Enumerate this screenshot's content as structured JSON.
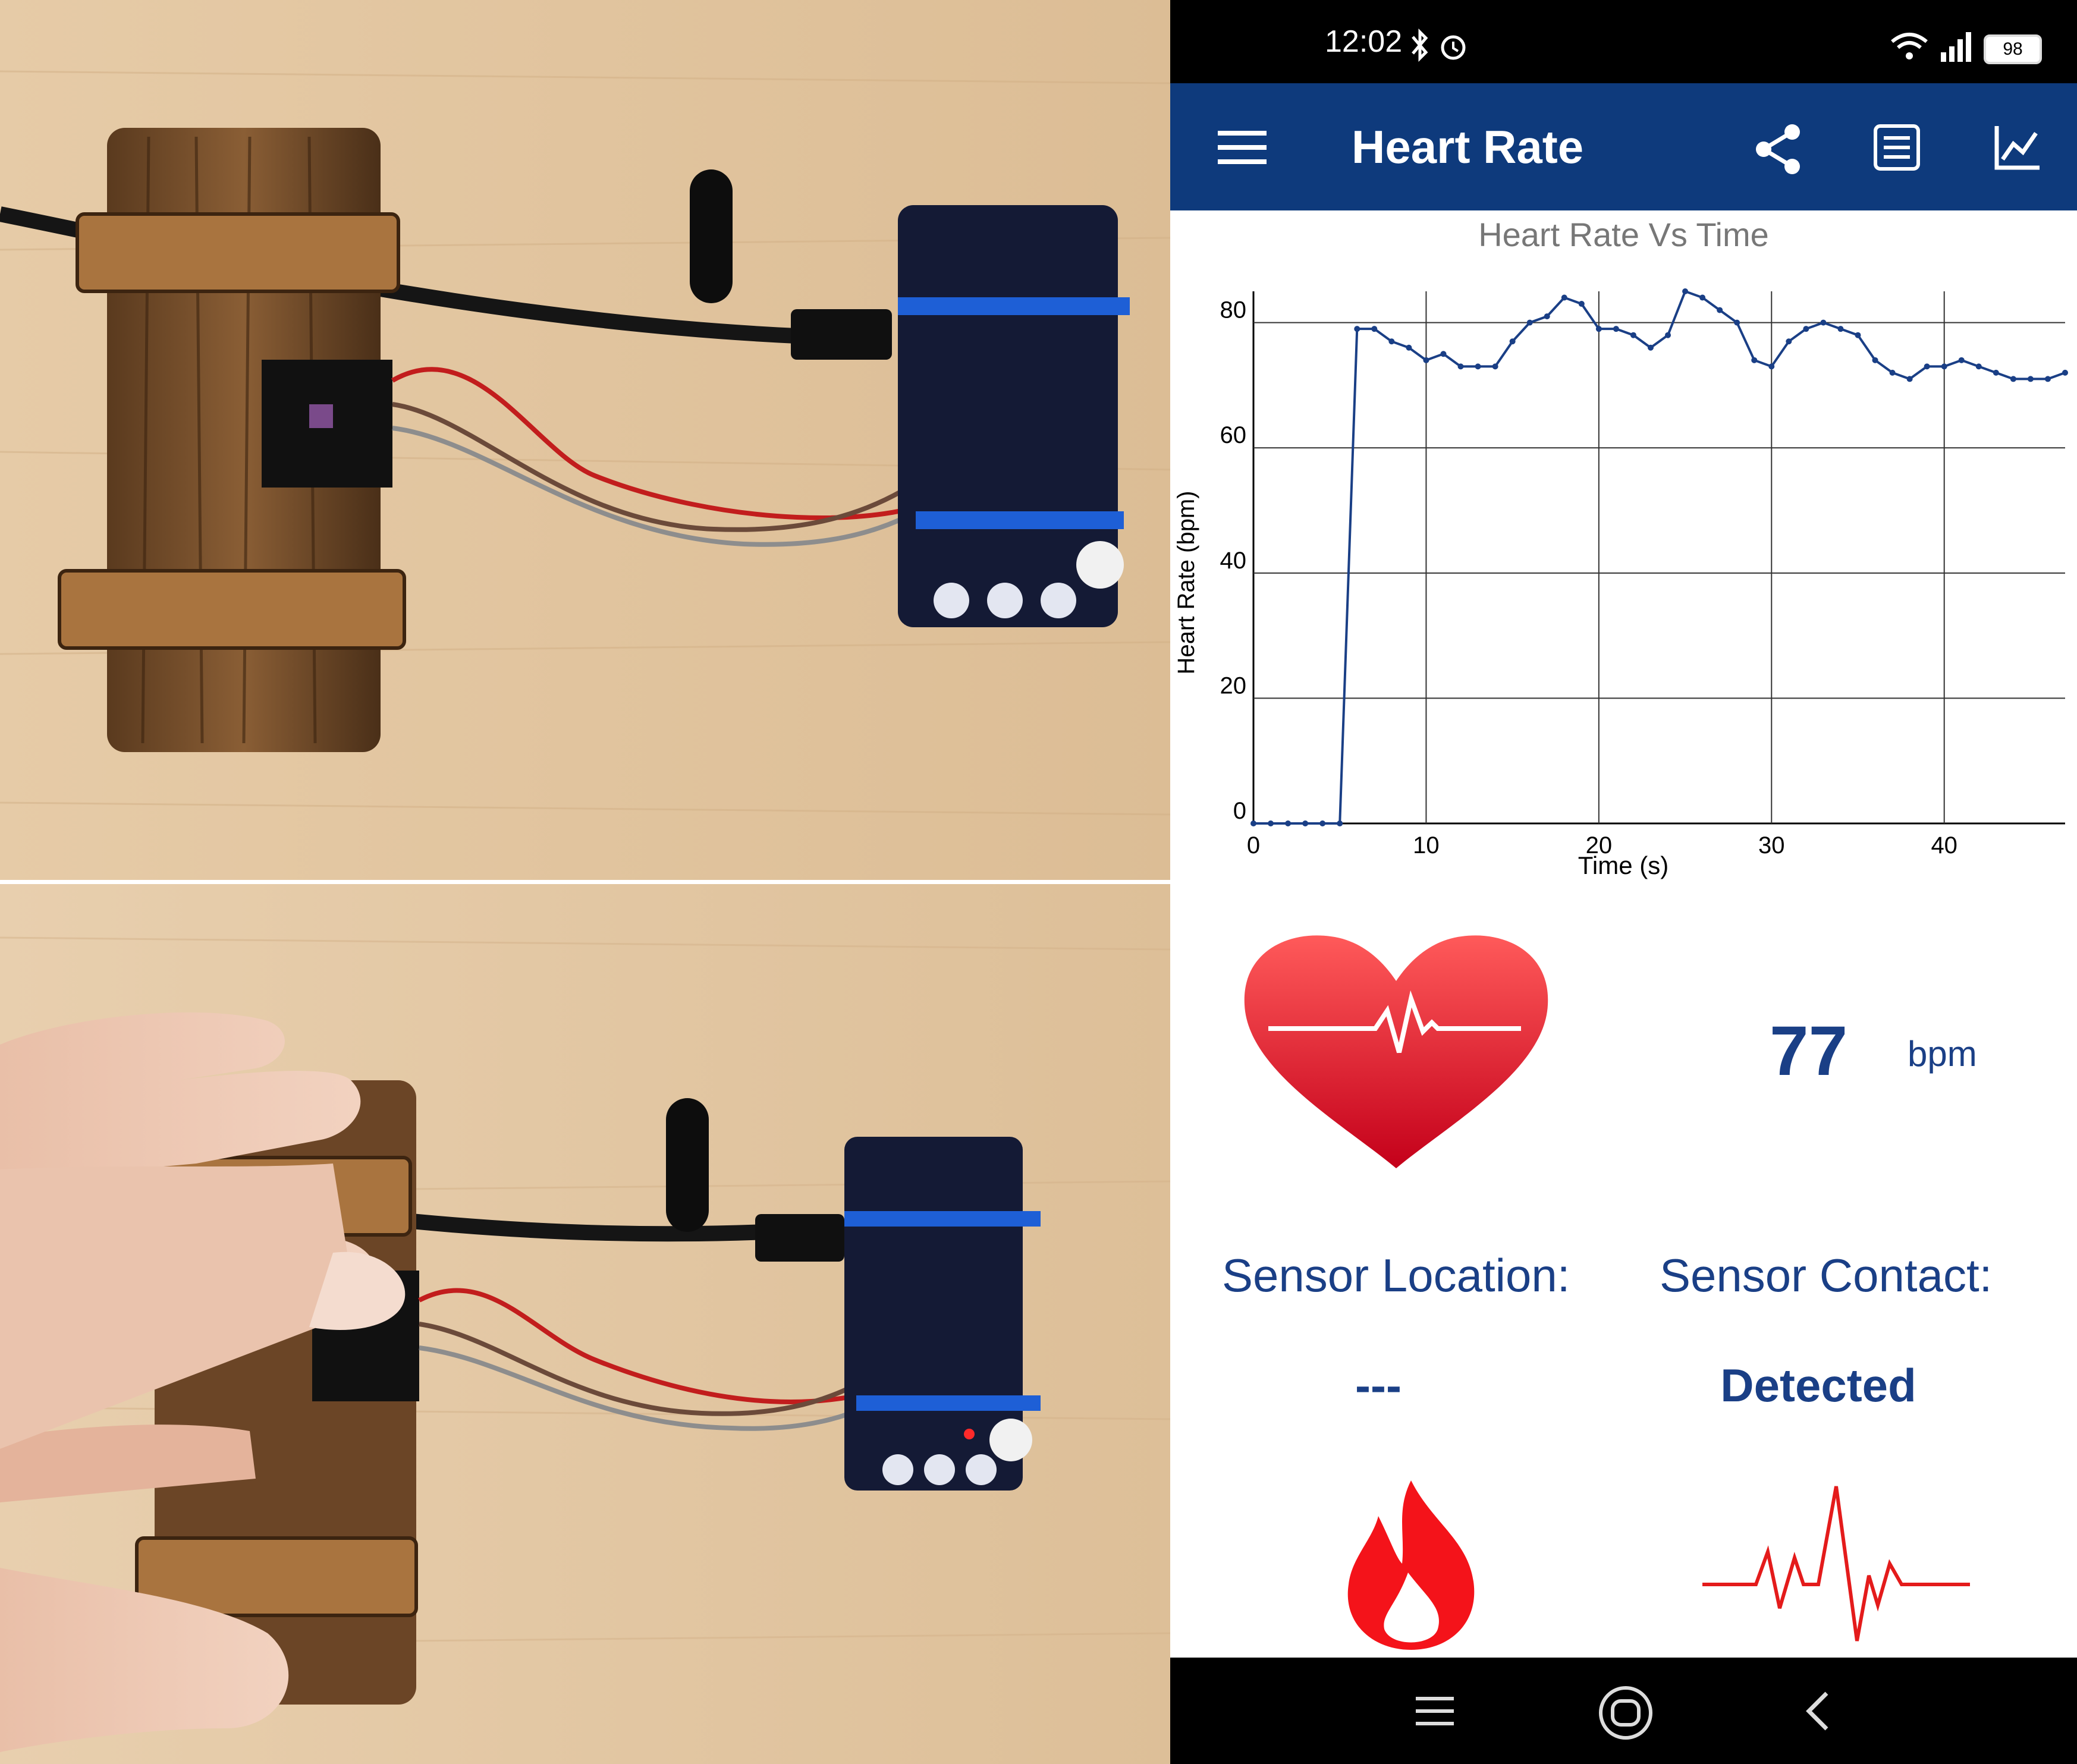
{
  "status_bar": {
    "time": "12:02",
    "battery": "98",
    "icons": [
      "bluetooth-icon",
      "alarm-icon",
      "wifi-icon",
      "signal-icon",
      "battery-icon"
    ]
  },
  "app_bar": {
    "title": "Heart Rate",
    "icons": [
      "menu-icon",
      "share-icon",
      "list-icon",
      "chart-icon"
    ],
    "color": "#0e3a7c"
  },
  "chart_data": {
    "type": "line",
    "title": "Heart Rate Vs Time",
    "xlabel": "Time (s)",
    "ylabel": "Heart Rate (bpm)",
    "xlim": [
      0,
      47
    ],
    "ylim": [
      0,
      85
    ],
    "xticks": [
      "0",
      "10",
      "20",
      "30",
      "40"
    ],
    "yticks": [
      "0",
      "20",
      "40",
      "60",
      "80"
    ],
    "grid": true,
    "color": "#1a3f86",
    "series": [
      {
        "x": [
          0,
          1,
          2,
          3,
          4,
          5,
          6,
          7,
          8,
          9,
          10,
          11,
          12,
          13,
          14,
          15,
          16,
          17,
          18,
          19,
          20,
          21,
          22,
          23,
          24,
          25,
          26,
          27,
          28,
          29,
          30,
          31,
          32,
          33,
          34,
          35,
          36,
          37,
          38,
          39,
          40,
          41,
          42,
          43,
          44,
          45,
          46,
          47
        ],
        "values": [
          0,
          0,
          0,
          0,
          0,
          0,
          79,
          79,
          77,
          76,
          74,
          75,
          73,
          73,
          73,
          77,
          80,
          81,
          84,
          83,
          79,
          79,
          78,
          76,
          78,
          85,
          84,
          82,
          80,
          74,
          73,
          77,
          79,
          80,
          79,
          78,
          74,
          72,
          71,
          73,
          73,
          74,
          73,
          72,
          71,
          71,
          71,
          72
        ]
      }
    ]
  },
  "reading": {
    "value": "77",
    "unit": "bpm"
  },
  "sensor": {
    "location_label": "Sensor Location:",
    "location_value": "---",
    "contact_label": "Sensor Contact:",
    "contact_value": "Detected"
  },
  "nav_bar": {
    "icons": [
      "recent-apps-icon",
      "home-icon",
      "back-icon"
    ]
  },
  "photos": {
    "top_caption": "",
    "bottom_caption": ""
  }
}
